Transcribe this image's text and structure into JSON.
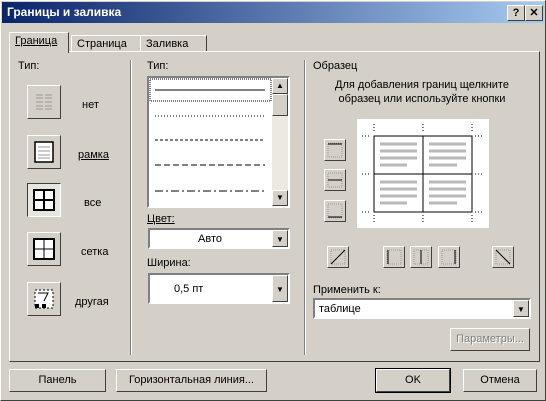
{
  "window": {
    "title": "Границы и заливка",
    "help_label": "?",
    "close_label": "✕"
  },
  "tabs": [
    {
      "label": "Граница",
      "active": true
    },
    {
      "label": "Страница",
      "active": false
    },
    {
      "label": "Заливка",
      "active": false
    }
  ],
  "setting": {
    "title": "Тип:",
    "items": [
      {
        "label": "нет",
        "icon": "none-border-icon"
      },
      {
        "label": "рамка",
        "icon": "box-border-icon"
      },
      {
        "label": "все",
        "icon": "all-border-icon",
        "selected": true
      },
      {
        "label": "сетка",
        "icon": "grid-border-icon"
      },
      {
        "label": "другая",
        "icon": "custom-border-icon"
      }
    ]
  },
  "style": {
    "title": "Тип:",
    "lines": [
      "solid",
      "dotted",
      "dash-small",
      "dash",
      "dash-dot"
    ],
    "color_label": "Цвет:",
    "color_value": "Авто",
    "width_label": "Ширина:",
    "width_value": "0,5 пт"
  },
  "preview": {
    "title": "Образец",
    "hint": "Для добавления границ щелкните образец или используйте кнопки",
    "apply_label": "Применить к:",
    "apply_value": "таблице",
    "options_label": "Параметры..."
  },
  "footer": {
    "panel_label": "Панель",
    "hline_label": "Горизонтальная линия...",
    "ok_label": "OK",
    "cancel_label": "Отмена"
  }
}
